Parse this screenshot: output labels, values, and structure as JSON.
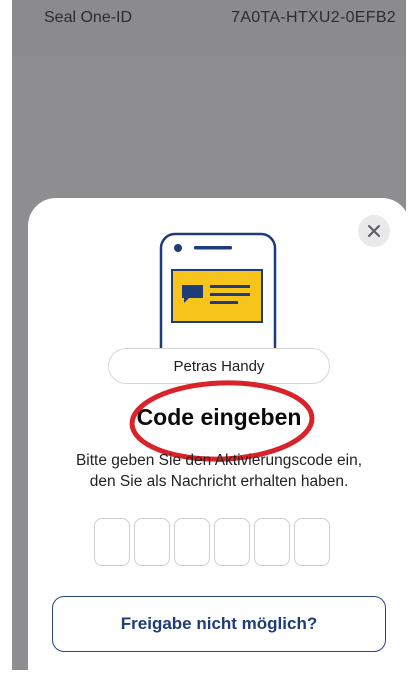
{
  "header": {
    "label": "Seal One-ID",
    "value": "7A0TA-HTXU2-0EFB2"
  },
  "sheet": {
    "device_name": "Petras Handy",
    "title": "Code eingeben",
    "subtitle_line1": "Bitte geben Sie den Aktivierungscode ein,",
    "subtitle_line2": "den Sie als Nachricht erhalten haben.",
    "code_length": 6,
    "help_button_label": "Freigabe nicht möglich?",
    "close_icon": "close-icon"
  },
  "colors": {
    "accent": "#274585",
    "illustration_yellow": "#f7c41b",
    "annotation_red": "#d9232a",
    "overlay_gray": "#8e8e90"
  }
}
